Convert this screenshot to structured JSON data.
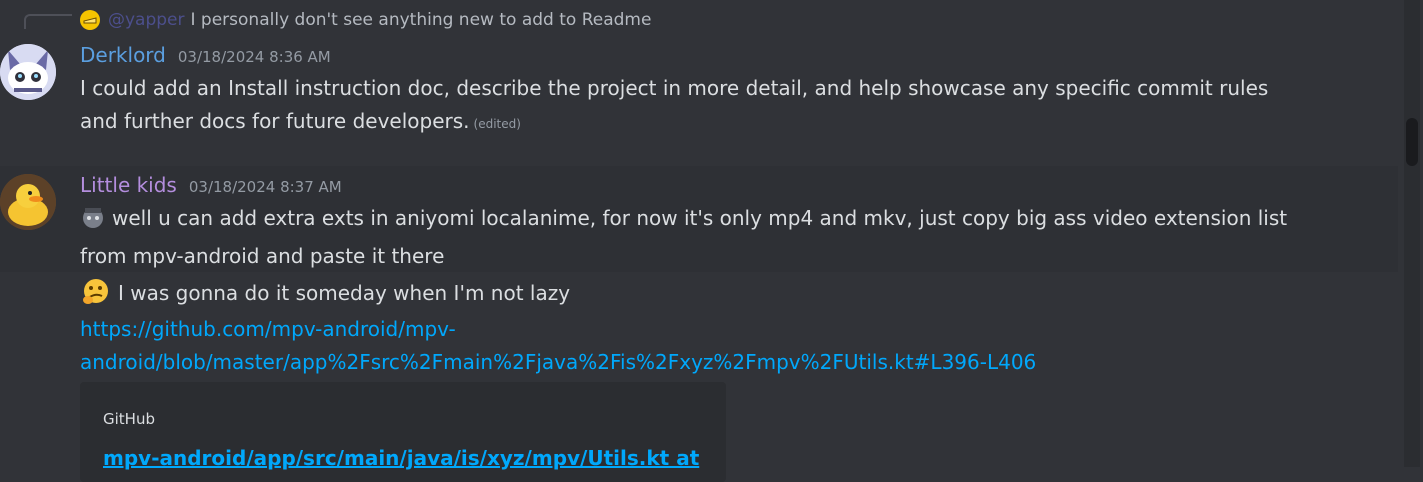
{
  "reply": {
    "author": "@yapper",
    "text": "I personally don't see anything new to add to Readme"
  },
  "messages": [
    {
      "author": "Derklord",
      "author_color": "#5b9fe0",
      "timestamp": "03/18/2024 8:36 AM",
      "line1": "I could add an Install instruction doc, describe the project in more detail, and help showcase any specific commit rules",
      "line2": "and further docs for future developers.",
      "edited": "(edited)"
    },
    {
      "author": "Little kids",
      "author_color": "#b48ede",
      "timestamp": "03/18/2024 8:37 AM",
      "line1": "well u can add extra exts in aniyomi localanime, for now it's only mp4 and mkv, just copy big ass video extension list",
      "line2": "from mpv-android and paste it there"
    }
  ],
  "followups": {
    "text": "I was gonna do it someday when I'm not lazy",
    "link_line1": "https://github.com/mpv-android/mpv-",
    "link_line2": "android/blob/master/app%2Fsrc%2Fmain%2Fjava%2Fis%2Fxyz%2Fmpv%2FUtils.kt#L396-L406"
  },
  "embed": {
    "provider": "GitHub",
    "title": "mpv-android/app/src/main/java/is/xyz/mpv/Utils.kt at"
  }
}
